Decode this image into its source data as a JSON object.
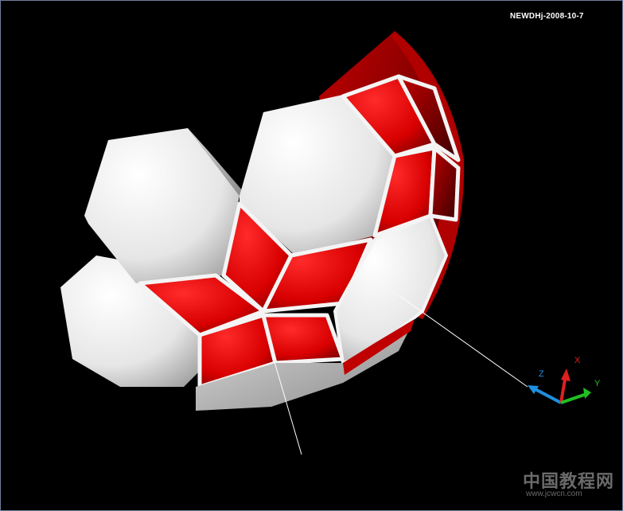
{
  "viewport": {
    "stamp": "NEWDHj-2008-10-7",
    "background_color": "#000000",
    "border_color": "#6f7f9a"
  },
  "model": {
    "description_icon": "soccer-ball-shell-icon",
    "panel_color_white": "#f2f2f2",
    "panel_color_red": "#e00000"
  },
  "ucs_icon": {
    "x_label": "X",
    "y_label": "Y",
    "z_label": "Z",
    "x_color": "#e02020",
    "y_color": "#20c020",
    "z_color": "#2090e0"
  },
  "watermark": {
    "site_cn": "中国教程网",
    "url": "www.jcwcn.com"
  }
}
